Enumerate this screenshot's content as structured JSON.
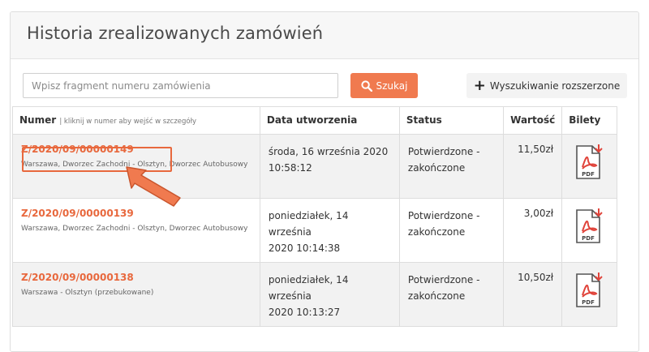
{
  "header": {
    "title": "Historia zrealizowanych zamówień"
  },
  "search": {
    "placeholder": "Wpisz fragment numeru zamówienia",
    "button_label": "Szukaj",
    "advanced_label": "Wyszukiwanie rozszerzone"
  },
  "table": {
    "columns": {
      "number": "Numer",
      "number_hint": "| kliknij w numer aby wejść w szczegóły",
      "created": "Data utworzenia",
      "status": "Status",
      "value": "Wartość",
      "tickets": "Bilety"
    },
    "rows": [
      {
        "number": "Z/2020/09/00000149",
        "route": "Warszawa, Dworzec Zachodni - Olsztyn, Dworzec Autobusowy",
        "date_line1": "środa, 16 września 2020",
        "date_line2": "10:58:12",
        "status_line1": "Potwierdzone -",
        "status_line2": "zakończone",
        "value": "11,50zł",
        "pdf_label": "PDF"
      },
      {
        "number": "Z/2020/09/00000139",
        "route": "Warszawa, Dworzec Zachodni - Olsztyn, Dworzec Autobusowy",
        "date_line1": "poniedziałek, 14 września",
        "date_line2": "2020 10:14:38",
        "status_line1": "Potwierdzone -",
        "status_line2": "zakończone",
        "value": "3,00zł",
        "pdf_label": "PDF"
      },
      {
        "number": "Z/2020/09/00000138",
        "route": "Warszawa - Olsztyn (przebukowane)",
        "date_line1": "poniedziałek, 14 września",
        "date_line2": "2020 10:13:27",
        "status_line1": "Potwierdzone -",
        "status_line2": "zakończone",
        "value": "10,50zł",
        "pdf_label": "PDF"
      }
    ]
  },
  "colors": {
    "accent": "#f07a4f",
    "link": "#e8683d",
    "pdf_red": "#e0433a"
  },
  "icons": {
    "search": "search-icon",
    "plus": "plus-icon",
    "pdf": "pdf-download-icon",
    "arrow": "pointer-arrow"
  }
}
